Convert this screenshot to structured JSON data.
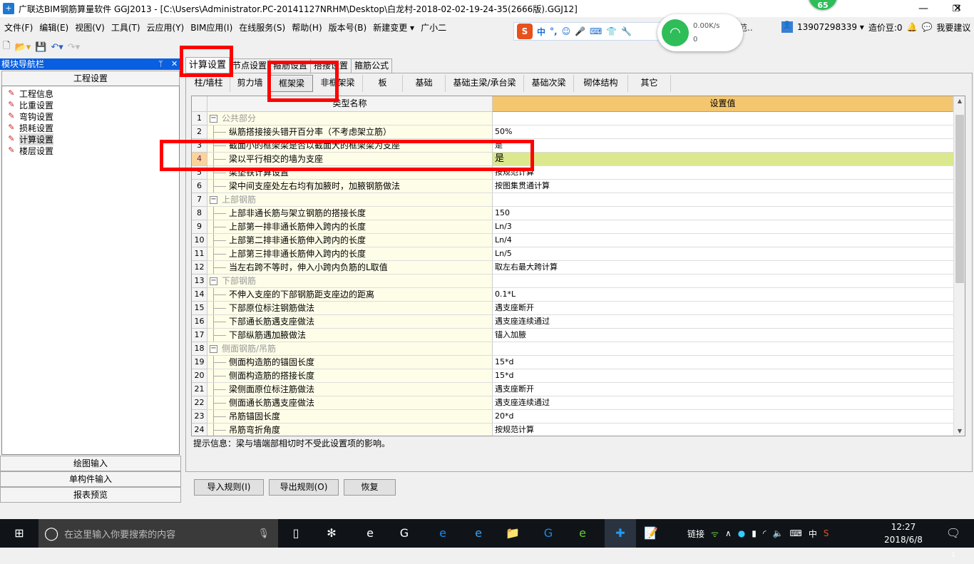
{
  "window": {
    "title": "广联达BIM钢筋算量软件 GGJ2013 - [C:\\Users\\Administrator.PC-20141127NRHM\\Desktop\\白龙村-2018-02-02-19-24-35(2666版).GGJ12]",
    "badge": "65",
    "minimize": "—",
    "restore": "❐",
    "close": "✕"
  },
  "menu": [
    "文件(F)",
    "编辑(E)",
    "视图(V)",
    "工具(T)",
    "云应用(Y)",
    "BIM应用(I)",
    "在线服务(S)",
    "帮助(H)",
    "版本号(B)",
    "新建变更 ▾",
    "广小二"
  ],
  "account": {
    "phone": "13907298339 ▾",
    "beans": "造价豆:0",
    "suggest": "我要建议",
    "partial": "范.."
  },
  "ime": {
    "logo": "S",
    "mode": "中",
    "punct": "°,"
  },
  "network": {
    "speed": "0.00K/s",
    "count": "0"
  },
  "left_panel": {
    "title": "模块导航栏",
    "pin": "ᛘ",
    "close": "✕",
    "header": "工程设置",
    "items": [
      {
        "label": "工程信息",
        "icon": "project-info-icon"
      },
      {
        "label": "比重设置",
        "icon": "density-icon"
      },
      {
        "label": "弯钩设置",
        "icon": "hook-icon"
      },
      {
        "label": "损耗设置",
        "icon": "loss-icon"
      },
      {
        "label": "计算设置",
        "icon": "calc-settings-icon",
        "selected": true
      },
      {
        "label": "楼层设置",
        "icon": "floor-icon"
      }
    ],
    "bottom": [
      "绘图输入",
      "单构件输入",
      "报表预览"
    ]
  },
  "tabs": [
    "计算设置",
    "节点设置",
    "箍筋设置",
    "搭接设置",
    "箍筋公式"
  ],
  "active_tab": "计算设置",
  "subtabs": [
    "柱/墙柱",
    "剪力墙",
    "框架梁",
    "非框架梁",
    "板",
    "基础",
    "基础主梁/承台梁",
    "基础次梁",
    "砌体结构",
    "其它"
  ],
  "active_subtab": "框架梁",
  "grid": {
    "col_name": "类型名称",
    "col_value": "设置值",
    "rows": [
      {
        "n": "1",
        "name": "公共部分",
        "value": "",
        "group": true
      },
      {
        "n": "2",
        "name": "纵筋搭接接头错开百分率（不考虑架立筋）",
        "value": "50%"
      },
      {
        "n": "3",
        "name": "截面小的框架梁是否以截面大的框架梁为支座",
        "value": "是"
      },
      {
        "n": "4",
        "name": "梁以平行相交的墙为支座",
        "value": "是",
        "selected": true
      },
      {
        "n": "5",
        "name": "梁垫铁计算设置",
        "value": "按规范计算"
      },
      {
        "n": "6",
        "name": "梁中间支座处左右均有加腋时，加腋钢筋做法",
        "value": "按图集贯通计算"
      },
      {
        "n": "7",
        "name": "上部钢筋",
        "value": "",
        "group": true
      },
      {
        "n": "8",
        "name": "上部非通长筋与架立钢筋的搭接长度",
        "value": "150"
      },
      {
        "n": "9",
        "name": "上部第一排非通长筋伸入跨内的长度",
        "value": "Ln/3"
      },
      {
        "n": "10",
        "name": "上部第二排非通长筋伸入跨内的长度",
        "value": "Ln/4"
      },
      {
        "n": "11",
        "name": "上部第三排非通长筋伸入跨内的长度",
        "value": "Ln/5"
      },
      {
        "n": "12",
        "name": "当左右跨不等时，伸入小跨内负筋的L取值",
        "value": "取左右最大跨计算"
      },
      {
        "n": "13",
        "name": "下部钢筋",
        "value": "",
        "group": true
      },
      {
        "n": "14",
        "name": "不伸入支座的下部钢筋距支座边的距离",
        "value": "0.1*L"
      },
      {
        "n": "15",
        "name": "下部原位标注钢筋做法",
        "value": "遇支座断开"
      },
      {
        "n": "16",
        "name": "下部通长筋遇支座做法",
        "value": "遇支座连续通过"
      },
      {
        "n": "17",
        "name": "下部纵筋遇加腋做法",
        "value": "锚入加腋"
      },
      {
        "n": "18",
        "name": "侧面钢筋/吊筋",
        "value": "",
        "group": true
      },
      {
        "n": "19",
        "name": "侧面构造筋的锚固长度",
        "value": "15*d"
      },
      {
        "n": "20",
        "name": "侧面构造筋的搭接长度",
        "value": "15*d"
      },
      {
        "n": "21",
        "name": "梁侧面原位标注筋做法",
        "value": "遇支座断开"
      },
      {
        "n": "22",
        "name": "侧面通长筋遇支座做法",
        "value": "遇支座连续通过"
      },
      {
        "n": "23",
        "name": "吊筋锚固长度",
        "value": "20*d"
      },
      {
        "n": "24",
        "name": "吊筋弯折角度",
        "value": "按规范计算"
      }
    ]
  },
  "hint": "提示信息：梁与墙端部相切时不受此设置项的影响。",
  "buttons": {
    "import": "导入规则(I)",
    "export": "导出规则(O)",
    "restore": "恢复"
  },
  "taskbar": {
    "search_placeholder": "在这里输入你要搜索的内容",
    "tray_link": "链接",
    "ime": "中",
    "time": "12:27",
    "date": "2018/6/8",
    "notifications": "1"
  },
  "colors": {
    "highlight_box": "#ff0000",
    "selected_value": "#dbe88e",
    "value_header": "#f4c66e",
    "nav_title": "#0a5fe0"
  }
}
